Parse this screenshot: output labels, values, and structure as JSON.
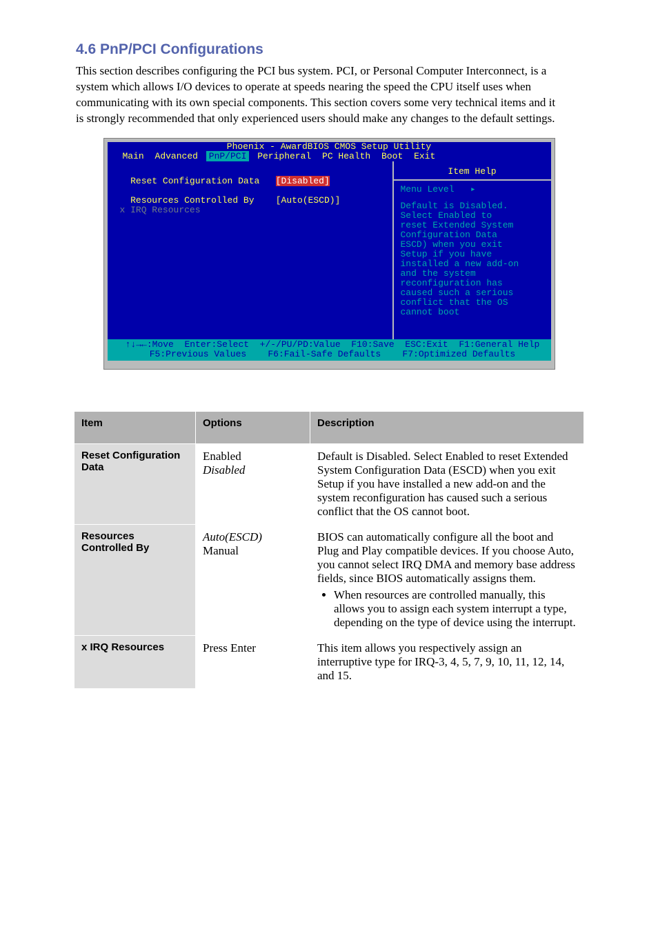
{
  "heading": "4.6 PnP/PCI Configurations",
  "intro": "This section describes configuring the PCI bus system. PCI, or Personal Computer Interconnect, is a system which allows I/O devices to operate at speeds nearing the speed the CPU itself uses when communicating with its own special components. This section covers some very technical items and it is strongly recommended that only experienced users should make any changes to the default settings.",
  "bios": {
    "title": "Phoenix - AwardBIOS CMOS Setup Utility",
    "tabs": [
      "Main",
      "Advanced",
      "PnP/PCI",
      "Peripheral",
      "PC Health",
      "Boot",
      "Exit"
    ],
    "sel_tab": 2,
    "left": {
      "l1": "  Reset Configuration Data   ",
      "l1v": "[Disabled]",
      "l2": "  Resources Controlled By    [Auto(ESCD)]",
      "l3": "x IRQ Resources"
    },
    "right": {
      "help_title": "Item Help",
      "menu_level": "Menu Level   ▸",
      "text": "Default is Disabled.\nSelect Enabled to\nreset Extended System\nConfiguration Data\nESCD) when you exit\nSetup if you have\ninstalled a new add-on\nand the system\nreconfiguration has\ncaused such a serious\nconflict that the OS\ncannot boot"
    },
    "foot1": "↑↓→←:Move  Enter:Select  +/-/PU/PD:Value  F10:Save  ESC:Exit  F1:General Help",
    "foot2": "F5:Previous Values    F6:Fail-Safe Defaults    F7:Optimized Defaults"
  },
  "table": {
    "head": [
      "Item",
      "Options",
      "Description"
    ],
    "rows": [
      {
        "item": "Reset Configuration Data",
        "opts": [
          "Enabled",
          "Disabled"
        ],
        "default_idx": 1,
        "desc": "Default is Disabled. Select Enabled to reset Extended System Configuration Data (ESCD) when you exit Setup if you have installed a new add-on and the system reconfiguration has caused such a serious conflict that the OS cannot boot."
      },
      {
        "item": "Resources Controlled By",
        "opts": [
          "Auto(ESCD)",
          "Manual"
        ],
        "default_idx": 0,
        "desc_pre": "BIOS can automatically configure all the boot and Plug and Play compatible devices. If you choose Auto, you cannot select IRQ DMA and memory base address fields, since BIOS automatically assigns them.",
        "desc_bullet": "When resources are controlled manually, this allows you to assign each system interrupt a type, depending on the type of device using the interrupt."
      },
      {
        "item": "x IRQ Resources",
        "opts": [
          "Press Enter"
        ],
        "default_idx": -1,
        "desc": "This item allows you respectively assign an interruptive type for IRQ-3, 4, 5, 7, 9, 10, 11, 12, 14, and 15."
      }
    ]
  }
}
